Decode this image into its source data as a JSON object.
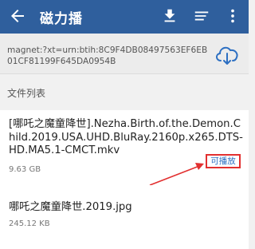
{
  "appbar": {
    "title": "磁力播",
    "back_icon": "arrow-left-icon",
    "download_icon": "download-icon",
    "sort_icon": "sort-lines-icon",
    "more_icon": "more-vert-icon",
    "bg_color": "#2f5f9d"
  },
  "magnet": {
    "text": "magnet:?xt=urn:btih:8C9F4DB08497563EF6EB01CF81199F645DA0954B",
    "cloud_icon": "cloud-download-icon"
  },
  "section": {
    "label": "文件列表"
  },
  "files": [
    {
      "name": "[哪吒之魔童降世].Nezha.Birth.of.the.Demon.Child.2019.USA.UHD.BluRay.2160p.x265.DTS-HD.MA5.1-CMCT.mkv",
      "size": "9.63 GB",
      "play_label": "可播放"
    },
    {
      "name": "哪吒之魔童降世.2019.jpg",
      "size": "245.12 KB"
    }
  ],
  "colors": {
    "annotation_red": "#e23030",
    "link_blue": "#2c6fc2"
  }
}
